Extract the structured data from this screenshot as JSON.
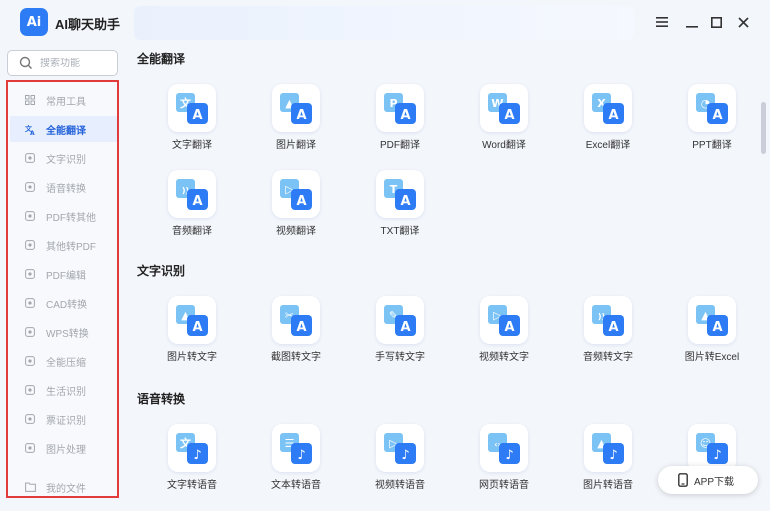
{
  "app": {
    "logo_text": "Ai",
    "title": "AI聊天助手"
  },
  "window_controls": [
    "menu-icon",
    "minimize-icon",
    "maximize-icon",
    "close-icon"
  ],
  "search": {
    "placeholder": "搜索功能"
  },
  "sidebar": {
    "items": [
      {
        "label": "常用工具",
        "icon": "grid-icon",
        "active": false
      },
      {
        "label": "全能翻译",
        "icon": "translate-icon",
        "active": true
      },
      {
        "label": "文字识别",
        "icon": "scan-text-icon",
        "active": false
      },
      {
        "label": "语音转换",
        "icon": "audio-convert-icon",
        "active": false
      },
      {
        "label": "PDF转其他",
        "icon": "pdf-export-icon",
        "active": false
      },
      {
        "label": "其他转PDF",
        "icon": "pdf-import-icon",
        "active": false
      },
      {
        "label": "PDF编辑",
        "icon": "pdf-edit-icon",
        "active": false
      },
      {
        "label": "CAD转换",
        "icon": "cad-icon",
        "active": false
      },
      {
        "label": "WPS转换",
        "icon": "wps-icon",
        "active": false
      },
      {
        "label": "全能压缩",
        "icon": "compress-icon",
        "active": false
      },
      {
        "label": "生活识别",
        "icon": "life-scan-icon",
        "active": false
      },
      {
        "label": "票证识别",
        "icon": "ticket-icon",
        "active": false
      },
      {
        "label": "图片处理",
        "icon": "image-edit-icon",
        "active": false
      },
      {
        "label": "我的文件",
        "icon": "folder-icon",
        "active": false
      }
    ]
  },
  "sections": [
    {
      "title": "全能翻译",
      "tiles": [
        {
          "label": "文字翻译",
          "glyph": "文A",
          "icon": "text-translate-icon"
        },
        {
          "label": "图片翻译",
          "glyph": "▲A",
          "icon": "image-translate-icon"
        },
        {
          "label": "PDF翻译",
          "glyph": "PA",
          "icon": "pdf-translate-icon"
        },
        {
          "label": "Word翻译",
          "glyph": "WA",
          "icon": "word-translate-icon"
        },
        {
          "label": "Excel翻译",
          "glyph": "XA",
          "icon": "excel-translate-icon"
        },
        {
          "label": "PPT翻译",
          "glyph": "◔A",
          "icon": "ppt-translate-icon"
        },
        {
          "label": "音频翻译",
          "glyph": "))A",
          "icon": "audio-translate-icon"
        },
        {
          "label": "视频翻译",
          "glyph": "▷A",
          "icon": "video-translate-icon"
        },
        {
          "label": "TXT翻译",
          "glyph": "TA",
          "icon": "txt-translate-icon"
        }
      ]
    },
    {
      "title": "文字识别",
      "tiles": [
        {
          "label": "图片转文字",
          "glyph": "▲A",
          "icon": "image-to-text-icon"
        },
        {
          "label": "截图转文字",
          "glyph": "✂A",
          "icon": "screenshot-to-text-icon"
        },
        {
          "label": "手写转文字",
          "glyph": "✎A",
          "icon": "handwriting-to-text-icon"
        },
        {
          "label": "视频转文字",
          "glyph": "▷A",
          "icon": "video-to-text-icon"
        },
        {
          "label": "音频转文字",
          "glyph": "))A",
          "icon": "audio-to-text-icon"
        },
        {
          "label": "图片转Excel",
          "glyph": "▲A",
          "icon": "image-to-excel-icon"
        }
      ]
    },
    {
      "title": "语音转换",
      "tiles": [
        {
          "label": "文字转语音",
          "glyph": "文♪",
          "icon": "text-to-speech-icon"
        },
        {
          "label": "文本转语音",
          "glyph": "☰♪",
          "icon": "doc-to-speech-icon"
        },
        {
          "label": "视频转语音",
          "glyph": "▷♪",
          "icon": "video-to-speech-icon"
        },
        {
          "label": "网页转语音",
          "glyph": "‹›♪",
          "icon": "web-to-speech-icon"
        },
        {
          "label": "图片转语音",
          "glyph": "▲♪",
          "icon": "image-to-speech-icon"
        },
        {
          "label": "",
          "glyph": "☺♪",
          "icon": "voice-clone-icon"
        }
      ]
    }
  ],
  "app_download": {
    "label": "APP下载",
    "icon": "phone-icon"
  },
  "colors": {
    "accent": "#2d7cf6",
    "sidebar_border": "#e23b3b",
    "active_bg": "#e7efff"
  }
}
